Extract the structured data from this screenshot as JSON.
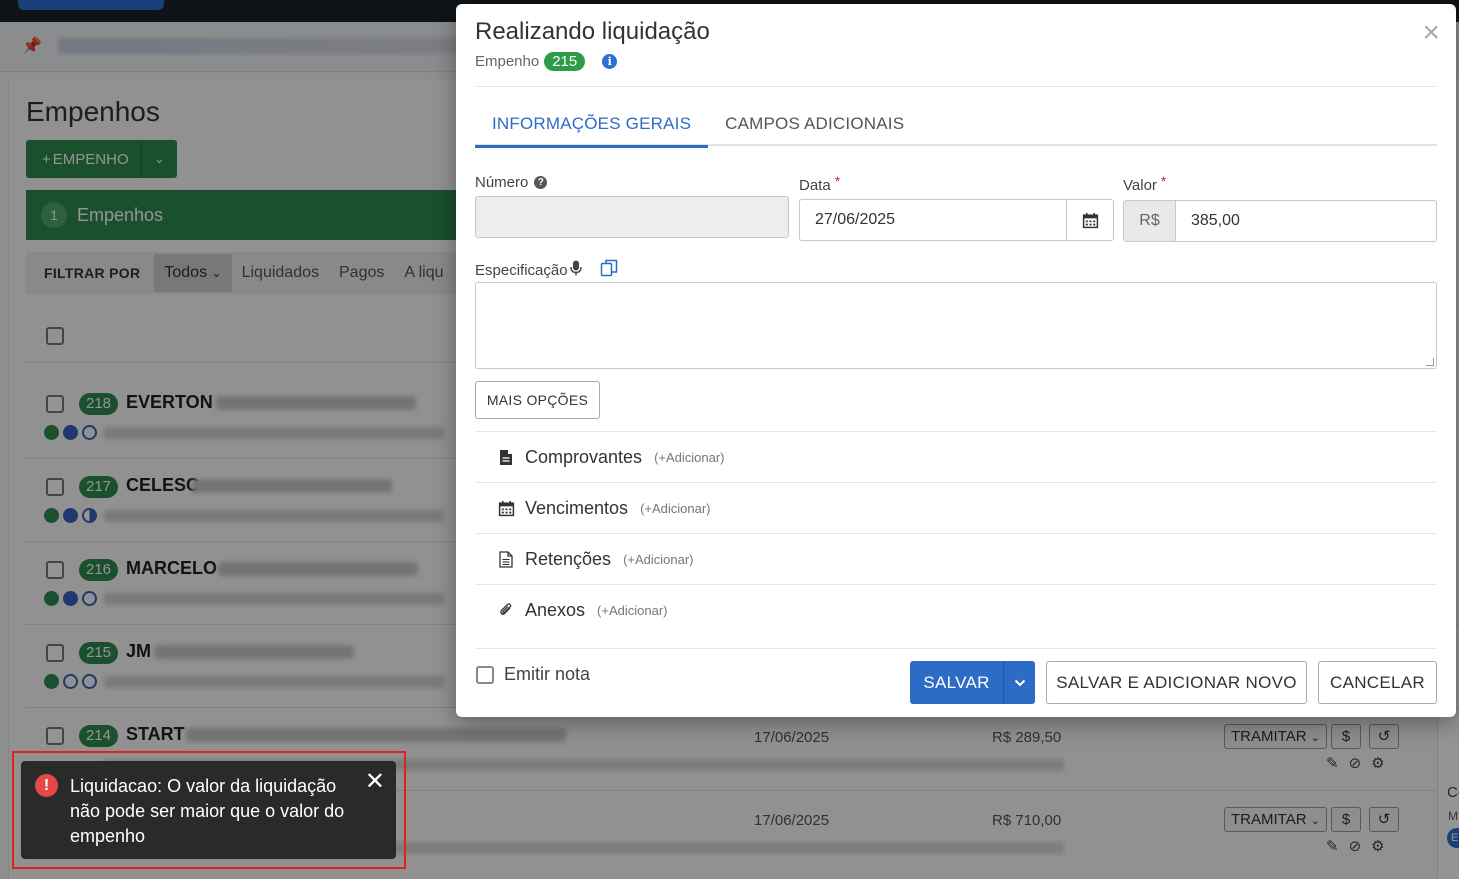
{
  "background": {
    "page_title": "Empenhos",
    "new_button_label": "EMPENHO",
    "banner_count": "1",
    "banner_label": "Empenhos",
    "filter": {
      "label": "FILTRAR POR",
      "selected": "Todos",
      "options": [
        "Liquidados",
        "Pagos",
        "A liqu"
      ]
    },
    "rows": [
      {
        "badge": "218",
        "name": "EVERTON"
      },
      {
        "badge": "217",
        "name": "CELESC"
      },
      {
        "badge": "216",
        "name": "MARCELO"
      },
      {
        "badge": "215",
        "name": "JM"
      },
      {
        "badge": "214",
        "name": "START",
        "date": "17/06/2025",
        "amount": "R$ 289,50",
        "action": "TRAMITAR"
      },
      {
        "date": "17/06/2025",
        "amount": "R$ 710,00",
        "action": "TRAMITAR"
      }
    ],
    "right_edge": {
      "c": "Co",
      "m": "M",
      "e": "E"
    }
  },
  "modal": {
    "title": "Realizando liquidação",
    "subtitle_label": "Empenho",
    "subtitle_badge": "215",
    "tabs": [
      {
        "label": "INFORMAÇÕES GERAIS",
        "active": true
      },
      {
        "label": "CAMPOS ADICIONAIS",
        "active": false
      }
    ],
    "fields": {
      "numero_label": "Número",
      "numero_value": "",
      "data_label": "Data",
      "data_value": "27/06/2025",
      "valor_label": "Valor",
      "valor_prefix": "R$",
      "valor_value": "385,00",
      "especificacao_label": "Especificação"
    },
    "more_options": "MAIS OPÇÕES",
    "sections": [
      {
        "label": "Comprovantes",
        "add": "(+Adicionar)",
        "icon": "file-icon"
      },
      {
        "label": "Vencimentos",
        "add": "(+Adicionar)",
        "icon": "calendar-icon"
      },
      {
        "label": "Retenções",
        "add": "(+Adicionar)",
        "icon": "document-icon"
      },
      {
        "label": "Anexos",
        "add": "(+Adicionar)",
        "icon": "paperclip-icon"
      }
    ],
    "emitir_nota": "Emitir nota",
    "buttons": {
      "save": "SALVAR",
      "save_new": "SALVAR E ADICIONAR NOVO",
      "cancel": "CANCELAR"
    }
  },
  "toast": {
    "message": "Liquidacao: O valor da liquidação não pode ser maior que o valor do empenho"
  },
  "colors": {
    "primary": "#2c6cc7",
    "success": "#2e8a4f",
    "danger": "#e22020",
    "toast_bg": "#2a2a2a"
  }
}
